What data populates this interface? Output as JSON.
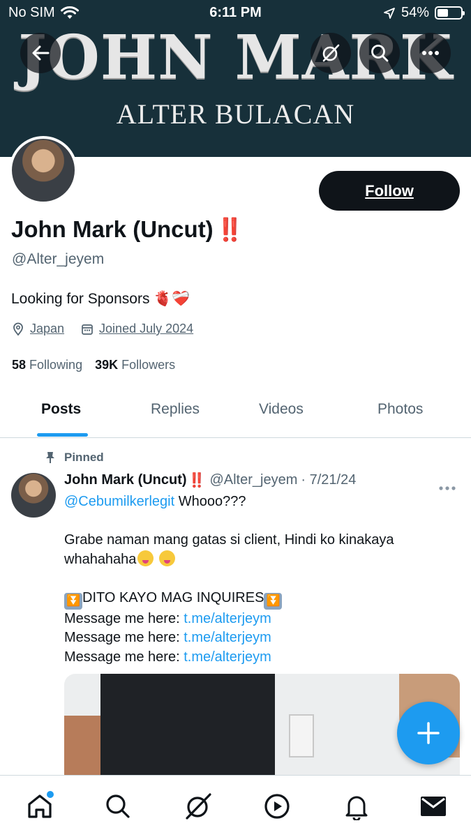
{
  "status_bar": {
    "carrier": "No SIM",
    "time": "6:11 PM",
    "battery": "54%",
    "battery_level": 0.54
  },
  "banner": {
    "title": "JOHN MARK",
    "subtitle": "ALTER BULACAN"
  },
  "profile": {
    "display_name": "John Mark (Uncut)",
    "name_emoji": "‼️",
    "handle": "@Alter_jeyem",
    "bio": "Looking for Sponsors 🫀❤️‍🩹",
    "location": "Japan",
    "joined": "Joined July 2024",
    "following_count": "58",
    "following_label": "Following",
    "followers_count": "39K",
    "followers_label": "Followers",
    "follow_button": "Follow"
  },
  "tabs": [
    {
      "label": "Posts",
      "active": true
    },
    {
      "label": "Replies",
      "active": false
    },
    {
      "label": "Videos",
      "active": false
    },
    {
      "label": "Photos",
      "active": false
    }
  ],
  "pinned_tweet": {
    "pinned_label": "Pinned",
    "author_name": "John Mark (Uncut)",
    "author_emoji": "‼️",
    "author_handle": "@Alter_jeyem",
    "date": "· 7/21/24",
    "mention": "@Cebumilkerlegit",
    "line1_rest": " Whooo???",
    "line2": "Grabe naman mang gatas si client, Hindi ko kinakaya whahahaha",
    "inquire_text": "DITO KAYO MAG INQUIRES",
    "message_label": "Message me here: ",
    "message_link": "t.me/alterjeym"
  },
  "colors": {
    "banner": "#17303a",
    "accent": "#1d9bf0",
    "text": "#0f1419",
    "secondary": "#536471"
  },
  "icons": {
    "back": "arrow-left-icon",
    "grok": "grok-icon",
    "search": "search-icon",
    "more": "more-horizontal-icon",
    "location": "location-pin-icon",
    "calendar": "calendar-icon",
    "pin": "pin-icon",
    "compose": "plus-icon",
    "nav": [
      "home-icon",
      "search-icon",
      "grok-icon",
      "play-icon",
      "bell-icon",
      "mail-icon"
    ]
  }
}
